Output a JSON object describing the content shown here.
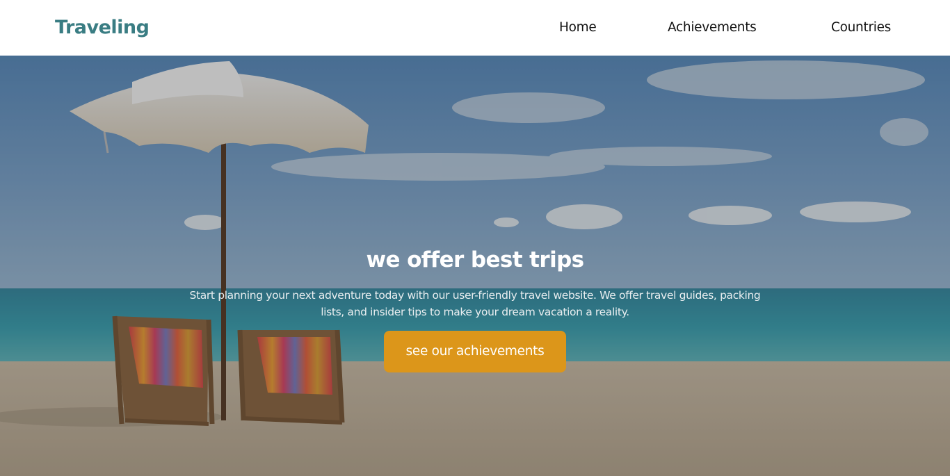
{
  "brand": {
    "name": "Traveling",
    "color": "#3a7d83"
  },
  "nav": {
    "items": [
      {
        "label": "Home"
      },
      {
        "label": "Achievements"
      },
      {
        "label": "Countries"
      }
    ]
  },
  "hero": {
    "title": "we offer best trips",
    "description": "Start planning your next adventure today with our user-friendly travel website. We offer travel guides, packing lists, and insider tips to make your dream vacation a reality.",
    "cta_label": "see our achievements",
    "cta_color": "#dc961a",
    "background": "beach-umbrella-deck-chairs-image"
  }
}
